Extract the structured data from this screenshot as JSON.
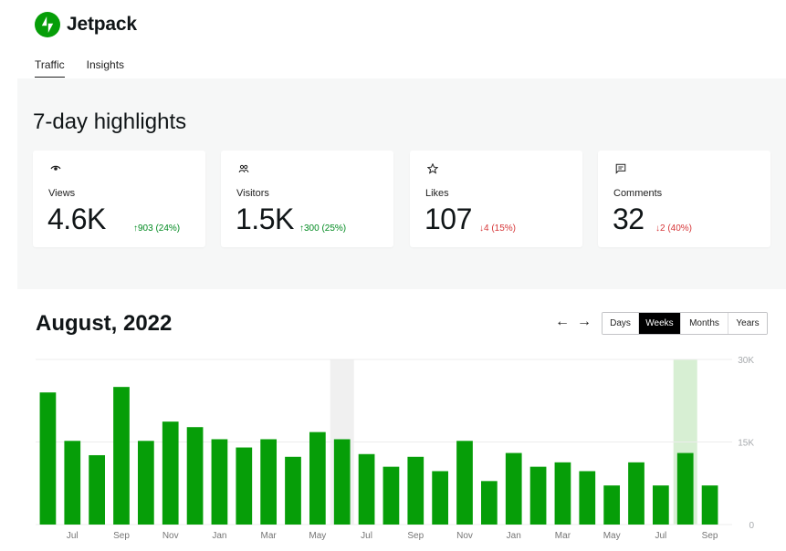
{
  "app": {
    "name": "Jetpack"
  },
  "tabs": [
    {
      "label": "Traffic",
      "active": true
    },
    {
      "label": "Insights",
      "active": false
    }
  ],
  "highlights": {
    "title": "7-day highlights",
    "cards": [
      {
        "icon": "eye-icon",
        "label": "Views",
        "value": "4.6K",
        "change": "↑903 (24%)",
        "direction": "up"
      },
      {
        "icon": "people-icon",
        "label": "Visitors",
        "value": "1.5K",
        "change": "↑300 (25%)",
        "direction": "up"
      },
      {
        "icon": "star-icon",
        "label": "Likes",
        "value": "107",
        "change": "↓4 (15%)",
        "direction": "down"
      },
      {
        "icon": "comment-icon",
        "label": "Comments",
        "value": "32",
        "change": "↓2 (40%)",
        "direction": "down"
      }
    ]
  },
  "period": {
    "title": "August, 2022",
    "prev_label": "←",
    "next_label": "→",
    "options": [
      "Days",
      "Weeks",
      "Months",
      "Years"
    ],
    "selected": "Weeks"
  },
  "colors": {
    "bar": "#069e08",
    "selected_band": "#d7efd3",
    "hover_band": "#f0f0f0",
    "up": "#008a20",
    "down": "#d63638"
  },
  "chart_data": {
    "type": "bar",
    "ylim": [
      0,
      30000
    ],
    "y_ticks": [
      {
        "value": 0,
        "label": "0"
      },
      {
        "value": 15000,
        "label": "15K"
      },
      {
        "value": 30000,
        "label": "30K"
      }
    ],
    "x_tick_labels": [
      {
        "index": 1,
        "label": "Jul"
      },
      {
        "index": 3,
        "label": "Sep"
      },
      {
        "index": 5,
        "label": "Nov"
      },
      {
        "index": 7,
        "label": "Jan"
      },
      {
        "index": 9,
        "label": "Mar"
      },
      {
        "index": 11,
        "label": "May"
      },
      {
        "index": 13,
        "label": "Jul"
      },
      {
        "index": 15,
        "label": "Sep"
      },
      {
        "index": 17,
        "label": "Nov"
      },
      {
        "index": 19,
        "label": "Jan"
      },
      {
        "index": 21,
        "label": "Mar"
      },
      {
        "index": 23,
        "label": "May"
      },
      {
        "index": 25,
        "label": "Jul"
      },
      {
        "index": 27,
        "label": "Sep"
      }
    ],
    "values": [
      24000,
      15200,
      12600,
      25000,
      15200,
      18700,
      17700,
      15500,
      14000,
      15500,
      12300,
      16800,
      15500,
      12800,
      10500,
      12300,
      9700,
      15200,
      7900,
      13000,
      10500,
      11300,
      9700,
      7100,
      11300,
      7100,
      13000,
      7100
    ],
    "hover_index": 12,
    "selected_index": 26,
    "grid": true
  }
}
